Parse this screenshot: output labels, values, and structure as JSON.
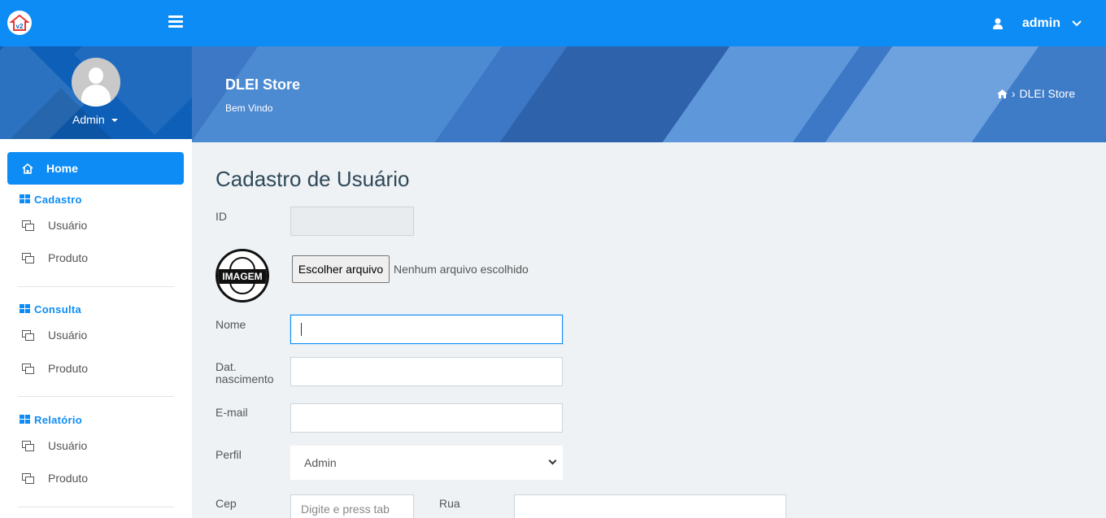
{
  "topbar": {
    "username": "admin",
    "icons": {
      "logo": "house-logo-icon",
      "menu": "hamburger-icon",
      "user": "user-icon",
      "dropdown": "chevron-down-icon"
    }
  },
  "sidebar": {
    "user_name": "Admin",
    "home": {
      "label": "Home",
      "icon": "home-icon"
    },
    "sections": [
      {
        "title": "Cadastro",
        "items": [
          "Usuário",
          "Produto"
        ]
      },
      {
        "title": "Consulta",
        "items": [
          "Usuário",
          "Produto"
        ]
      },
      {
        "title": "Relatório",
        "items": [
          "Usuário",
          "Produto"
        ]
      }
    ]
  },
  "banner": {
    "title": "DLEI Store",
    "subtitle": "Bem Vindo",
    "breadcrumb": "DLEI Store"
  },
  "form": {
    "title": "Cadastro de Usuário",
    "id_label": "ID",
    "id_value": "",
    "image_badge": "IMAGEM",
    "file_button": "Escolher arquivo",
    "file_status": "Nenhum arquivo escolhido",
    "nome_label": "Nome",
    "nome_value": "",
    "nascimento_label": "Dat. nascimento",
    "email_label": "E-mail",
    "perfil_label": "Perfil",
    "perfil_value": "Admin",
    "cep_label": "Cep",
    "cep_placeholder": "Digite e press tab",
    "rua_label": "Rua"
  },
  "colors": {
    "primary": "#0d8cf5",
    "sidebar_head": "#0e5fb8",
    "banner": "#3c78c5",
    "background": "#eef2f5"
  }
}
